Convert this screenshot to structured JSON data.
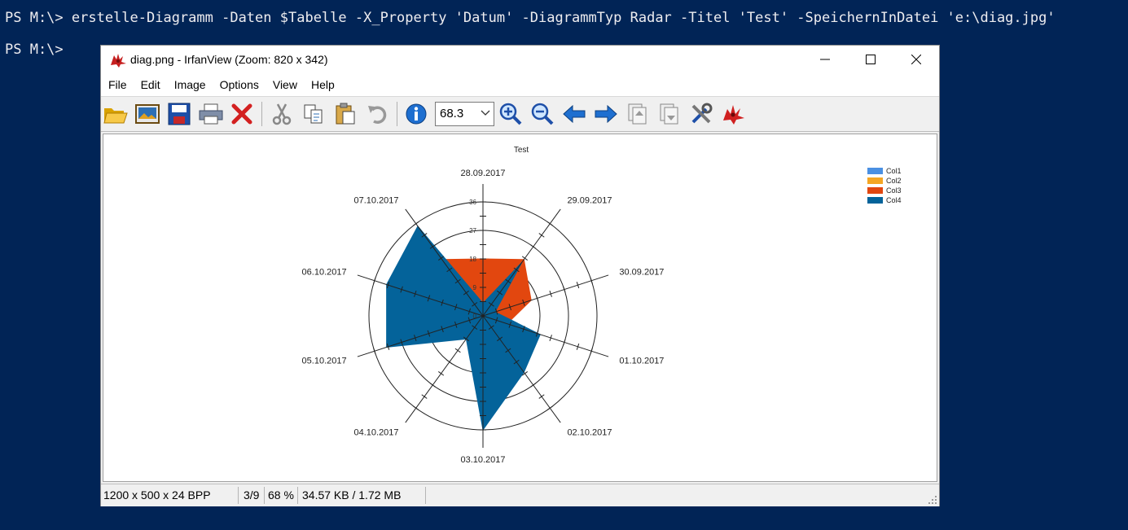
{
  "console": {
    "line1": "PS M:\\> erstelle-Diagramm -Daten $Tabelle -X_Property 'Datum' -DiagrammTyp Radar -Titel 'Test' -SpeichernInDatei 'e:\\diag.jpg'",
    "line2": "PS M:\\>"
  },
  "window": {
    "title": "diag.png - IrfanView (Zoom: 820 x 342)",
    "controls": {
      "minimize": "—",
      "maximize": "☐",
      "close": "✕"
    }
  },
  "menu": [
    {
      "label": "File"
    },
    {
      "label": "Edit"
    },
    {
      "label": "Image"
    },
    {
      "label": "Options"
    },
    {
      "label": "View"
    },
    {
      "label": "Help"
    }
  ],
  "toolbar": {
    "zoom_value": "68.3",
    "icons": [
      "open-icon",
      "slideshow-icon",
      "save-icon",
      "print-icon",
      "delete-icon",
      "cut-icon",
      "copy-icon",
      "paste-icon",
      "undo-icon",
      "info-icon",
      "zoom-in-icon",
      "zoom-out-icon",
      "previous-icon",
      "next-icon",
      "first-page-icon",
      "last-page-icon",
      "properties-icon",
      "irfanview-logo-icon"
    ]
  },
  "statusbar": {
    "dims": "1200 x 500 x 24 BPP",
    "index": "3/9",
    "zoom": "68 %",
    "size": "34.57 KB / 1.72 MB"
  },
  "chart_data": {
    "type": "radar",
    "title": "Test",
    "categories": [
      "28.09.2017",
      "29.09.2017",
      "30.09.2017",
      "01.10.2017",
      "02.10.2017",
      "03.10.2017",
      "04.10.2017",
      "05.10.2017",
      "06.10.2017",
      "07.10.2017"
    ],
    "rlim": [
      0,
      36
    ],
    "ticks": [
      0,
      9,
      18,
      27,
      36
    ],
    "grid": true,
    "legend": "top-right",
    "series": [
      {
        "name": "Col1",
        "color": "#4a90e2",
        "values": [
          18,
          16,
          4,
          4,
          6,
          8,
          4,
          4,
          4,
          4
        ]
      },
      {
        "name": "Col2",
        "color": "#f5a623",
        "values": [
          0,
          0,
          0,
          0,
          0,
          0,
          0,
          0,
          0,
          0
        ]
      },
      {
        "name": "Col3",
        "color": "#e2470f",
        "values": [
          18,
          22,
          16,
          8,
          4,
          4,
          4,
          12,
          14,
          22
        ]
      },
      {
        "name": "Col4",
        "color": "#04639a",
        "values": [
          4,
          21,
          4,
          19,
          22,
          36,
          9,
          32,
          32,
          35
        ]
      }
    ]
  }
}
